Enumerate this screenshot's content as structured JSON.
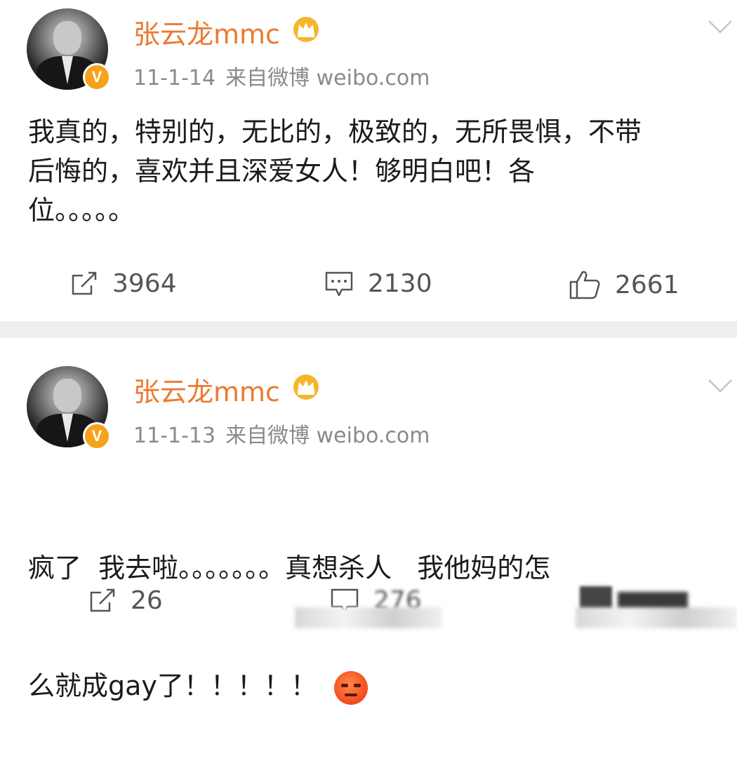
{
  "posts": [
    {
      "username": "张云龙mmc",
      "date": "11-1-14",
      "source": "来自微博 weibo.com",
      "content": "我真的，特别的，无比的，极致的，无所畏惧，不带\n后悔的，喜欢并且深爱女人！够明白吧！各\n位。。。。。",
      "repost_count": "3964",
      "comment_count": "2130",
      "like_count": "2661"
    },
    {
      "username": "张云龙mmc",
      "date": "11-1-13",
      "source": "来自微博 weibo.com",
      "content_line1": "疯了  我去啦。。。。。。。真想杀人   我他妈的怎",
      "content_line2": "么就成gay了！！！！！",
      "repost_count": "26",
      "comment_count": "276",
      "like_count": ""
    }
  ],
  "icons": {
    "verified": "V",
    "crown": "crown-icon",
    "more": "chevron-down-icon",
    "repost": "repost-icon",
    "comment": "comment-icon",
    "like": "like-icon",
    "emoji": "angry-face-emoji"
  },
  "colors": {
    "username": "#ea7a32",
    "verified_badge": "#f7a21b",
    "meta": "#8a8a8a",
    "divider": "#efefef"
  }
}
